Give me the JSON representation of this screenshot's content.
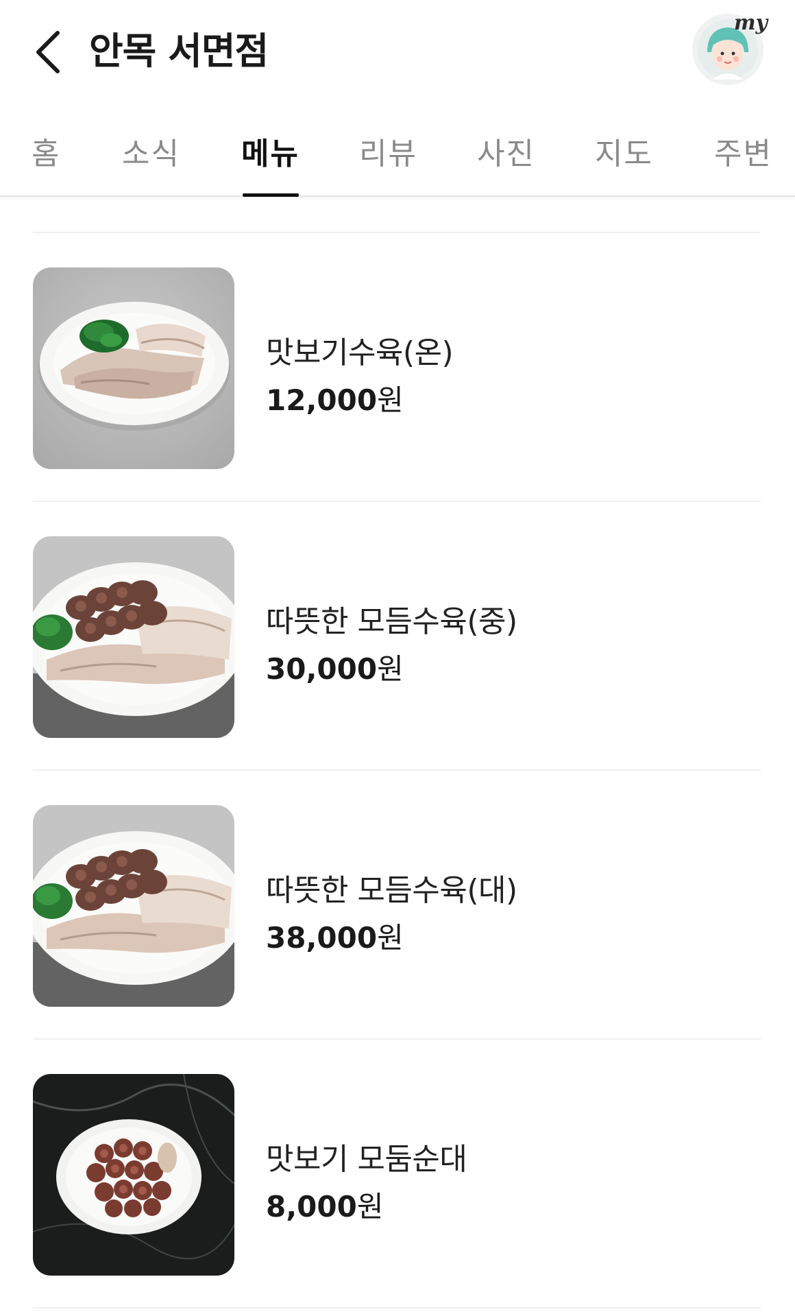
{
  "header": {
    "title": "안목 서면점",
    "avatar_label": "my"
  },
  "tabs": [
    {
      "label": "홈"
    },
    {
      "label": "소식"
    },
    {
      "label": "메뉴",
      "active": true
    },
    {
      "label": "리뷰"
    },
    {
      "label": "사진"
    },
    {
      "label": "지도"
    },
    {
      "label": "주변"
    }
  ],
  "menu": [
    {
      "name": "맛보기수육(온)",
      "price": "12,000",
      "unit": "원",
      "image": "sliced-pork-plate"
    },
    {
      "name": "따뜻한 모듬수육(중)",
      "price": "30,000",
      "unit": "원",
      "image": "pork-sundae-plate"
    },
    {
      "name": "따뜻한 모듬수육(대)",
      "price": "38,000",
      "unit": "원",
      "image": "pork-sundae-plate"
    },
    {
      "name": "맛보기 모둠순대",
      "price": "8,000",
      "unit": "원",
      "image": "sundae-plate-dark"
    }
  ],
  "colors": {
    "active_tab": "#111111",
    "inactive_tab": "#8a8a8a",
    "divider": "#f0f0f0"
  }
}
